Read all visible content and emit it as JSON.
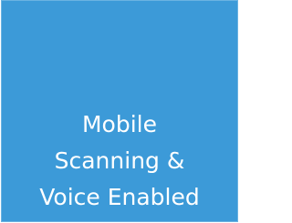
{
  "tile": {
    "lines": [
      "Mobile",
      "Scanning &",
      "Voice Enabled"
    ],
    "background_color": "#3C9AD8",
    "text_color": "#FFFFFF"
  }
}
